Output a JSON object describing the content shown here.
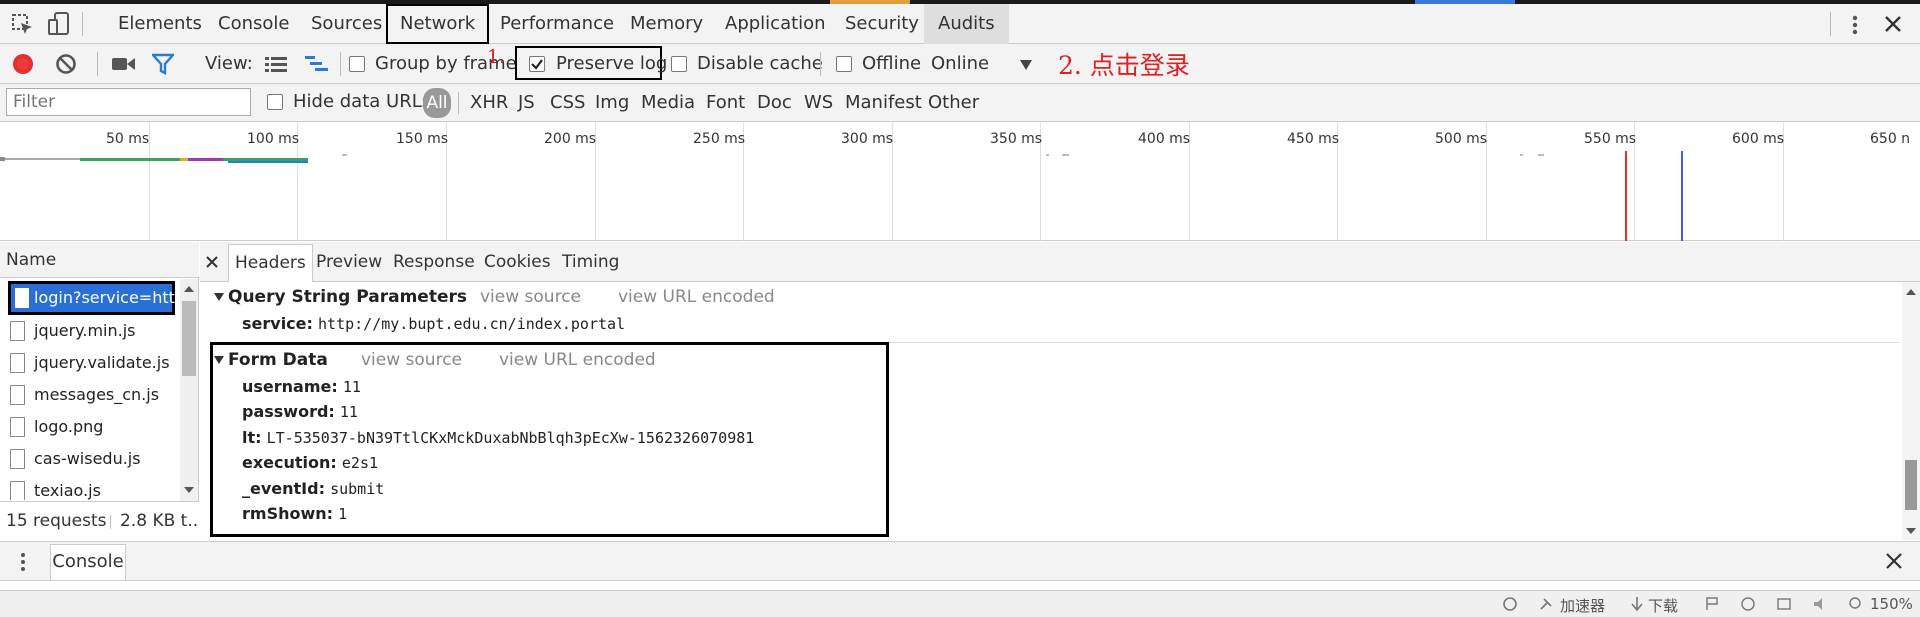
{
  "tabs": [
    "Elements",
    "Console",
    "Sources",
    "Network",
    "Performance",
    "Memory",
    "Application",
    "Security",
    "Audits"
  ],
  "toolbar": {
    "view_label": "View:",
    "group_by_frame": "Group by frame",
    "preserve_log": "Preserve log",
    "disable_cache": "Disable cache",
    "offline": "Offline",
    "throttle": "Online",
    "annotation_1": "1.",
    "annotation_2": "2. 点击登录"
  },
  "filter": {
    "placeholder": "Filter",
    "hide_data_urls": "Hide data URLs",
    "types": [
      "All",
      "XHR",
      "JS",
      "CSS",
      "Img",
      "Media",
      "Font",
      "Doc",
      "WS",
      "Manifest",
      "Other"
    ]
  },
  "timeline": {
    "ticks": [
      "50 ms",
      "100 ms",
      "150 ms",
      "200 ms",
      "250 ms",
      "300 ms",
      "350 ms",
      "400 ms",
      "450 ms",
      "500 ms",
      "550 ms",
      "600 ms",
      "650 n"
    ]
  },
  "requests": {
    "header": "Name",
    "files": [
      "login?service=htt",
      "jquery.min.js",
      "jquery.validate.js",
      "messages_cn.js",
      "logo.png",
      "cas-wisedu.js",
      "texiao.js"
    ],
    "summary": "15 requests",
    "transferred": "2.8 KB t..."
  },
  "details": {
    "tabs": [
      "Headers",
      "Preview",
      "Response",
      "Cookies",
      "Timing"
    ],
    "qsp": {
      "title": "Query String Parameters",
      "view_source": "view source",
      "view_url_encoded": "view URL encoded",
      "params": [
        {
          "k": "service:",
          "v": "http://my.bupt.edu.cn/index.portal"
        }
      ]
    },
    "form": {
      "title": "Form Data",
      "view_source": "view source",
      "view_url_encoded": "view URL encoded",
      "params": [
        {
          "k": "username:",
          "v": "11"
        },
        {
          "k": "password:",
          "v": "11"
        },
        {
          "k": "lt:",
          "v": "LT-535037-bN39TtlCKxMckDuxabNbBlqh3pEcXw-1562326070981"
        },
        {
          "k": "execution:",
          "v": "e2s1"
        },
        {
          "k": "_eventId:",
          "v": "submit"
        },
        {
          "k": "rmShown:",
          "v": "1"
        }
      ]
    }
  },
  "drawer": {
    "tab": "Console"
  },
  "status": {
    "accelerator": "加速器",
    "download": "下载",
    "zoom": "150%"
  }
}
